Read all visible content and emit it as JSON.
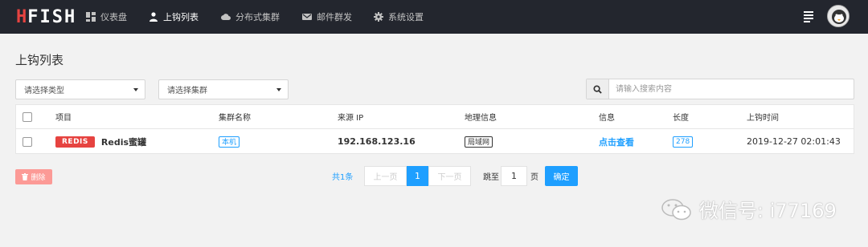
{
  "nav": {
    "logo_h": "H",
    "logo_rest": "FISH",
    "items": [
      {
        "label": "仪表盘",
        "icon": "dashboard-icon"
      },
      {
        "label": "上钩列表",
        "icon": "user-hook-icon",
        "active": true
      },
      {
        "label": "分布式集群",
        "icon": "cloud-icon"
      },
      {
        "label": "邮件群发",
        "icon": "mail-icon"
      },
      {
        "label": "系统设置",
        "icon": "gear-icon"
      }
    ]
  },
  "page": {
    "title": "上钩列表"
  },
  "filters": {
    "type_select": "请选择类型",
    "cluster_select": "请选择集群",
    "search_placeholder": "请输入搜索内容"
  },
  "table": {
    "headers": [
      "项目",
      "集群名称",
      "来源 IP",
      "地理信息",
      "信息",
      "长度",
      "上钩时间"
    ],
    "rows": [
      {
        "tag": "REDIS",
        "project": "Redis蜜罐",
        "cluster": "本机",
        "ip": "192.168.123.16",
        "geo": "局域网",
        "info": "点击查看",
        "length": "278",
        "time": "2019-12-27 02:01:43"
      }
    ]
  },
  "actions": {
    "delete_label": "删除"
  },
  "pagination": {
    "total": "共1条",
    "prev": "上一页",
    "current": "1",
    "next": "下一页",
    "jump_label": "跳至",
    "jump_value": "1",
    "page_unit": "页",
    "confirm": "确定"
  },
  "watermark": "微信号: i77169",
  "colors": {
    "nav_bg": "#23262e",
    "accent": "#1e9fff",
    "danger": "#e64340",
    "delete_btn": "#fc9a96"
  }
}
